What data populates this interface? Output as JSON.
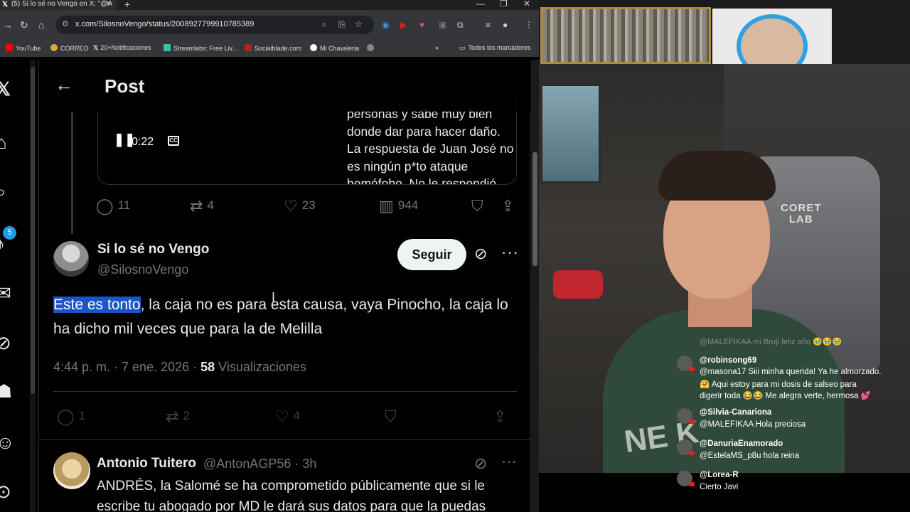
{
  "browser": {
    "tab_title": "(5) Si lo sé no Vengo en X: \"@A",
    "url": "x.com/SilosnoVengo/status/2008927799910785389",
    "bookmarks": [
      {
        "label": "YouTube",
        "color": "#ff0000"
      },
      {
        "label": "CORREO",
        "color": "#e8a23a"
      },
      {
        "label": "20+Notificaciones",
        "color": "#ffffff"
      },
      {
        "label": "Streamlabs: Free Liv...",
        "color": "#31c3a2"
      },
      {
        "label": "Socialblade.com",
        "color": "#b3261e"
      },
      {
        "label": "Mi Chavaleria",
        "color": "#ffffff"
      }
    ],
    "all_bookmarks_label": "Todos los marcadores"
  },
  "xnav": {
    "notifications_badge": "5"
  },
  "header": {
    "title": "Post"
  },
  "quoted_video": {
    "time": "0:22",
    "caption_lines": [
      "personas y sabe muy bien",
      "donde dar para hacer daño.",
      "La respuesta de Juan José no",
      "es ningún p*to ataque",
      "homófobo. No le respondió"
    ]
  },
  "parent_actions": {
    "replies": "11",
    "reposts": "4",
    "likes": "23",
    "views": "944"
  },
  "post": {
    "author_name": "Si lo sé no Vengo",
    "author_handle": "@SilosnoVengo",
    "follow_label": "Seguir",
    "text_highlight": "Este es tonto",
    "text_rest": ", la caja no es para esta causa, vaya Pinocho, la caja lo ha dicho mil veces que para la de Melilla",
    "timestamp": "4:44 p. m. · 7 ene. 2026 · ",
    "views_count": "58",
    "views_label": " Visualizaciones",
    "replies": "1",
    "reposts": "2",
    "likes": "4"
  },
  "reply": {
    "author_name": "Antonio Tuitero",
    "author_handle_time": "@AntonAGP56 · 3h",
    "text_lines": [
      "ANDRÉS,  la Salomé se ha comprometido públicamente que si le",
      "escribe tu abogado por MD le dará sus datos para que la puedas"
    ]
  },
  "chat": {
    "faint_line": "@MALEFIKAA mi Bruji feliz año 🥹🥹🥹",
    "messages": [
      {
        "user": "@robinsong69",
        "lines": [
          "@masona17 Siii minha querida! Ya he almorzado.",
          "🤗 Aqui estoy para mi dosis de salseo para",
          "digerir toda 😂😂 Me alegra verte, hermosa 💕"
        ]
      },
      {
        "user": "@Silvia-Canariona",
        "lines": [
          "@MALEFIKAA Hola preciosa"
        ]
      },
      {
        "user": "@DanuriaEnamorado",
        "lines": [
          "@EstelaMS_p8u hola reina"
        ]
      },
      {
        "user": "@Lorea-R",
        "lines": [
          "Cierto Javi"
        ]
      }
    ]
  },
  "stream": {
    "chair_logo": "CORET\nLAB",
    "shirt_text": "NE K"
  },
  "colors": {
    "accent": "#1d9bf0",
    "highlight": "#1a56c8",
    "muted": "#71767b"
  }
}
